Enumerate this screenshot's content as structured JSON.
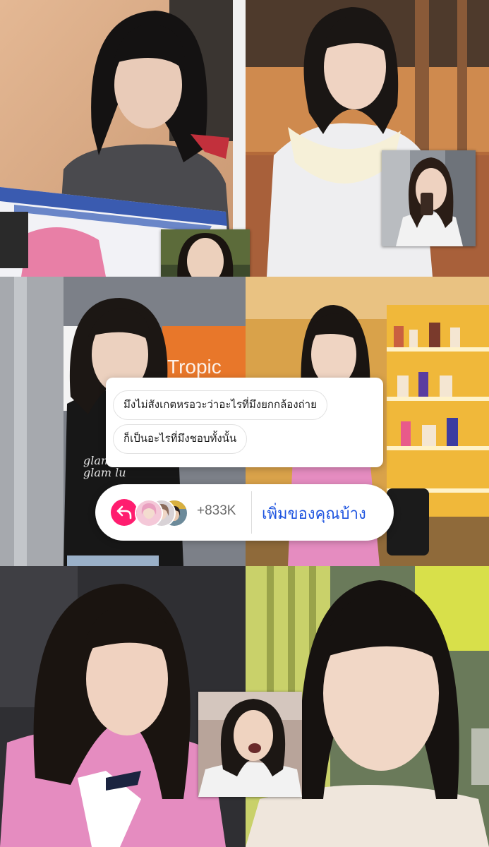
{
  "question": {
    "line1": "มึงไม่สังเกตหรอวะว่าอะไรที่มึงยกกล้องถ่าย",
    "line2": "ก็เป็นอะไรที่มึงชอบทั้งนั้น"
  },
  "add_yours": {
    "count": "+833K",
    "cta_label": "เพิ่มของคุณบ้าง",
    "accent_color": "#ff1d6f",
    "cta_color": "#1f55e0"
  },
  "backdrop_text": {
    "store_sign": "Tropic",
    "shirt_print": "glam glam lu"
  },
  "icons": {
    "reply": "reply-arrow-icon"
  }
}
